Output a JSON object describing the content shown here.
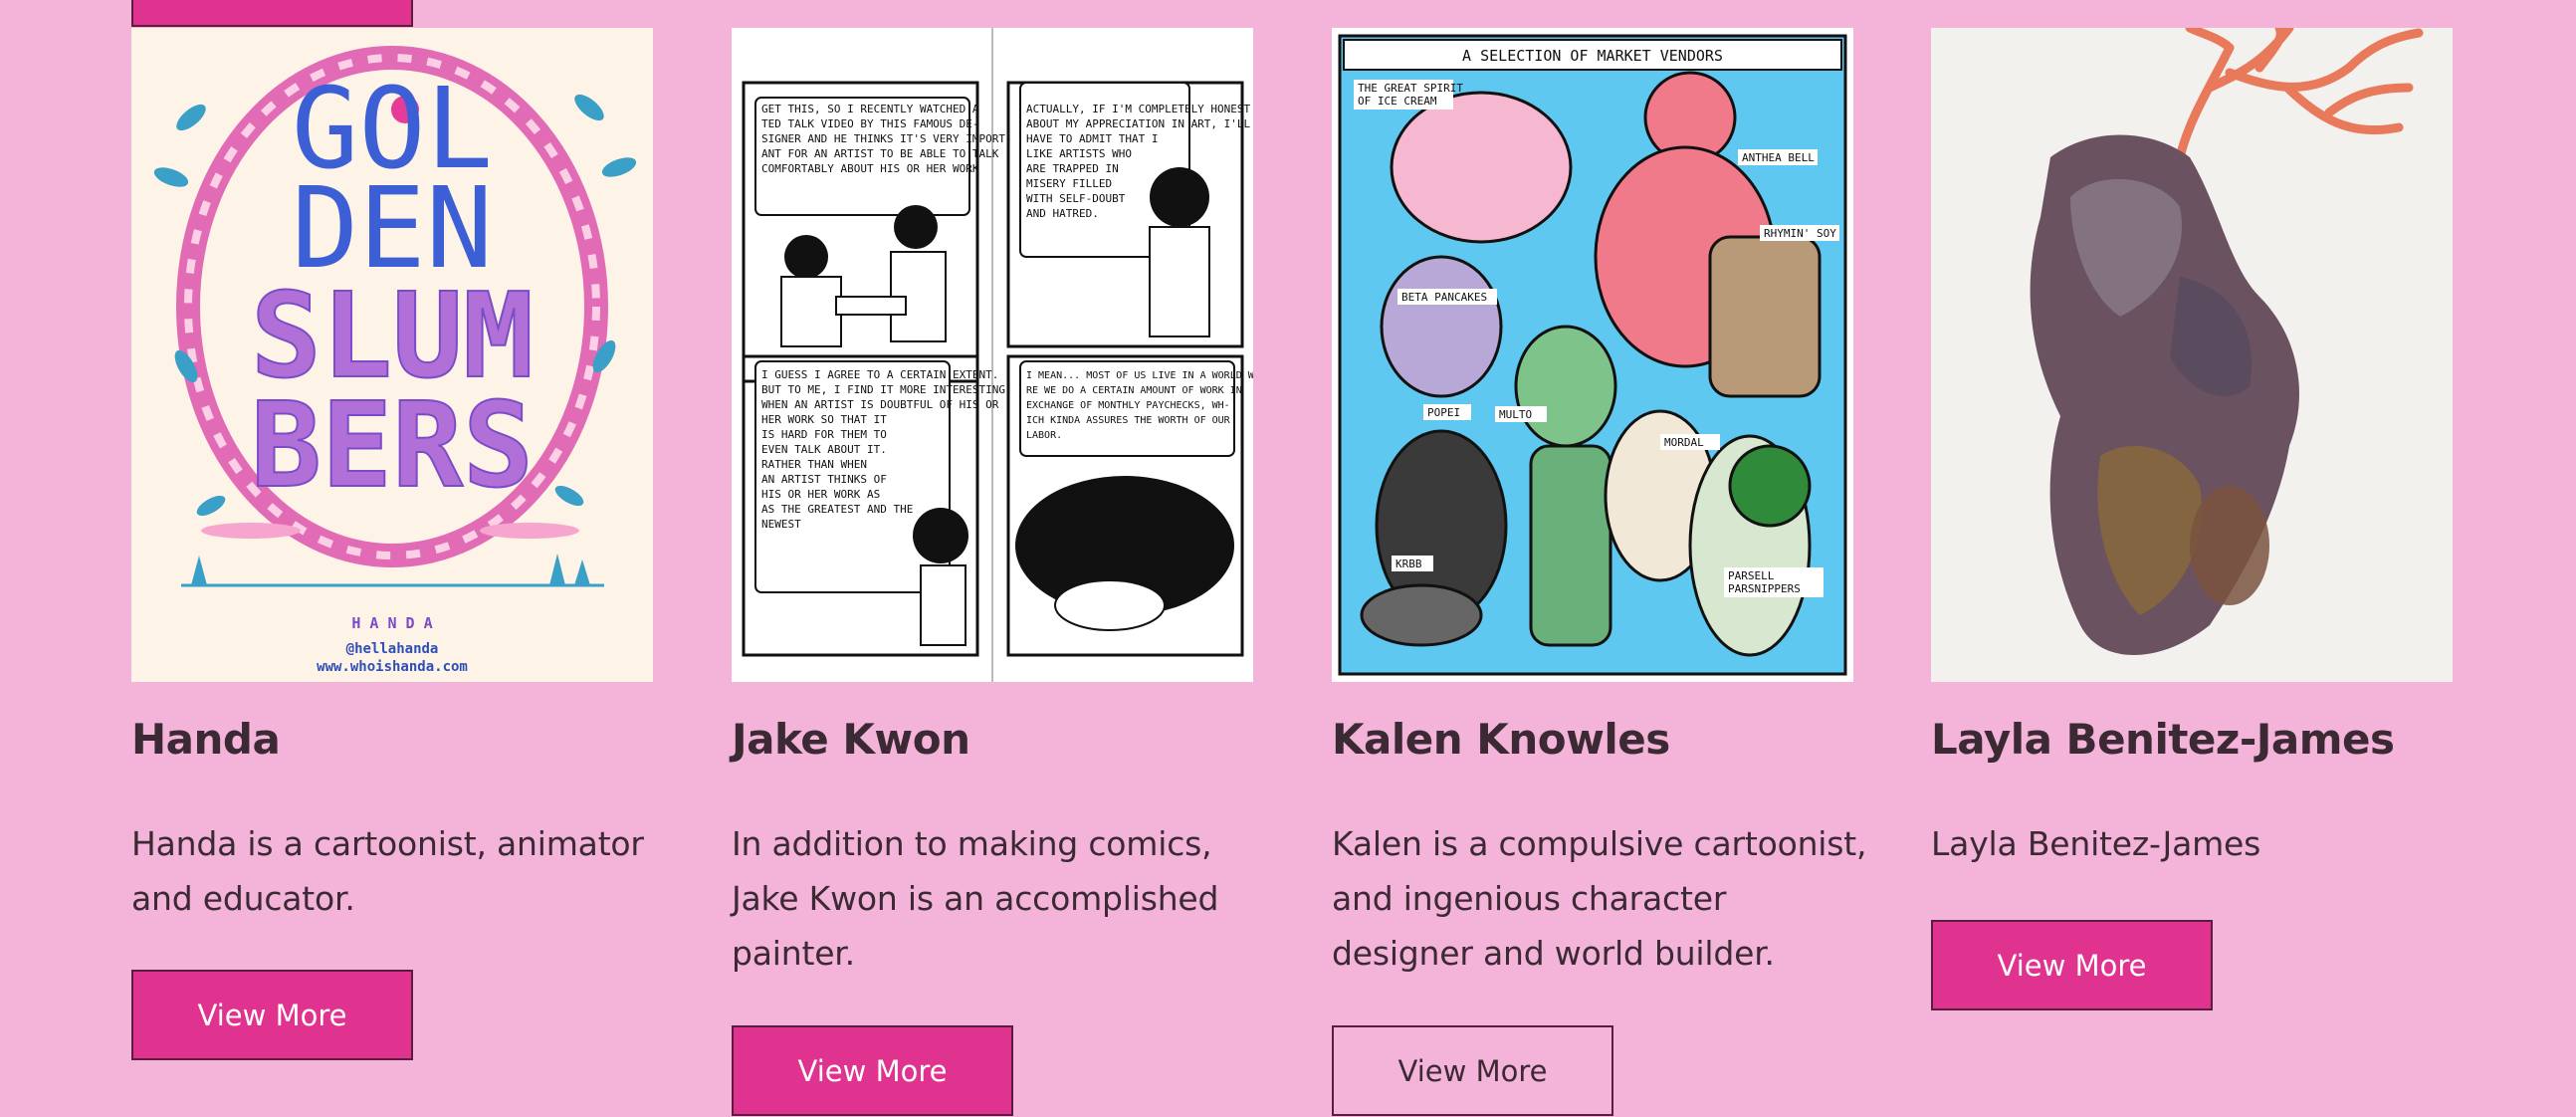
{
  "cards": [
    {
      "name": "Handa",
      "description": "Handa is a cartoonist, animator and educator.",
      "button": "View More",
      "art": {
        "title_lines": [
          "GOL",
          "DEN",
          "SLUM",
          "BERS"
        ],
        "credit_name": "H A N D A",
        "credit_handle": "@hellahanda",
        "credit_url": "www.whoishanda.com"
      }
    },
    {
      "name": "Jake Kwon",
      "description": "In addition to making comics, Jake Kwon is an accomplished painter.",
      "button": "View More",
      "art": {
        "panel1": [
          "GET THIS, SO I RECENTLY WATCHED A",
          "TED TALK VIDEO BY THIS FAMOUS DE-",
          "SIGNER AND HE THINKS IT'S VERY IMPORT-",
          "ANT FOR AN ARTIST TO BE ABLE TO TALK",
          "COMFORTABLY ABOUT HIS OR HER WORK"
        ],
        "panel2": [
          "ACTUALLY, IF I'M COMPLETELY HONEST",
          "ABOUT MY APPRECIATION IN ART, I'LL",
          "HAVE TO ADMIT THAT I",
          "LIKE ARTISTS WHO",
          "ARE TRAPPED IN",
          "MISERY FILLED",
          "WITH SELF-DOUBT",
          "AND HATRED."
        ],
        "panel3": [
          "I GUESS I AGREE TO A CERTAIN EXTENT.",
          "BUT TO ME, I FIND IT MORE INTERESTING",
          "WHEN AN ARTIST IS DOUBTFUL OF HIS OR",
          "HER WORK SO THAT IT",
          "IS HARD FOR THEM TO",
          "EVEN TALK ABOUT IT.",
          "RATHER THAN WHEN",
          "AN ARTIST THINKS OF",
          "HIS OR HER WORK AS",
          "AS THE GREATEST AND THE",
          "NEWEST"
        ],
        "panel4": [
          "I MEAN... MOST OF US LIVE IN A WORLD WHE-",
          "RE WE DO A CERTAIN AMOUNT OF WORK IN",
          "EXCHANGE OF MONTHLY PAYCHECKS, WH-",
          "ICH KINDA ASSURES THE WORTH OF OUR",
          "LABOR."
        ]
      }
    },
    {
      "name": "Kalen Knowles",
      "description": "Kalen is a compulsive cartoonist, and ingenious character designer and world builder.",
      "button": "View More",
      "art": {
        "header": "A SELECTION OF MARKET VENDORS",
        "labels": [
          "THE GREAT SPIRIT",
          "OF ICE CREAM",
          "ANTHEA BELL",
          "RHYMIN' SOY",
          "BETA PANCAKES",
          "POPEI",
          "MULTO",
          "MORDAL",
          "KRBB",
          "PARSELL",
          "PARSNIPPERS"
        ]
      }
    },
    {
      "name": "Layla Benitez-James",
      "description": "Layla Benitez-James",
      "button": "View More"
    }
  ]
}
